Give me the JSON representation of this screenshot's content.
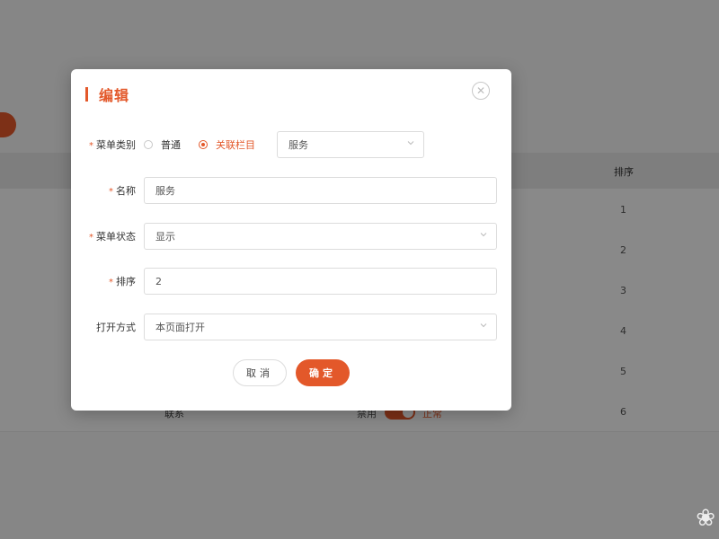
{
  "background_table": {
    "header_sort": "排序",
    "rows": [
      {
        "sort": "1",
        "name": "",
        "status": "",
        "state": ""
      },
      {
        "sort": "2",
        "name": "",
        "status": "",
        "state": ""
      },
      {
        "sort": "3",
        "name": "",
        "status": "",
        "state": ""
      },
      {
        "sort": "4",
        "name": "",
        "status": "",
        "state": ""
      },
      {
        "sort": "5",
        "name": "",
        "status": "",
        "state": ""
      },
      {
        "sort": "6",
        "name": "联系",
        "status": "禁用",
        "state": "正常"
      }
    ]
  },
  "modal": {
    "title": "编辑",
    "close_icon": "close-circle-icon",
    "menu_type": {
      "label": "菜单类别",
      "options": [
        "普通",
        "关联栏目"
      ],
      "selected": "关联栏目",
      "linked_column": "服务"
    },
    "name": {
      "label": "名称",
      "value": "服务"
    },
    "menu_status": {
      "label": "菜单状态",
      "value": "显示"
    },
    "sort": {
      "label": "排序",
      "value": "2"
    },
    "open_mode": {
      "label": "打开方式",
      "value": "本页面打开"
    },
    "cancel_label": "取消",
    "confirm_label": "确定"
  },
  "colors": {
    "accent": "#e3582a"
  }
}
